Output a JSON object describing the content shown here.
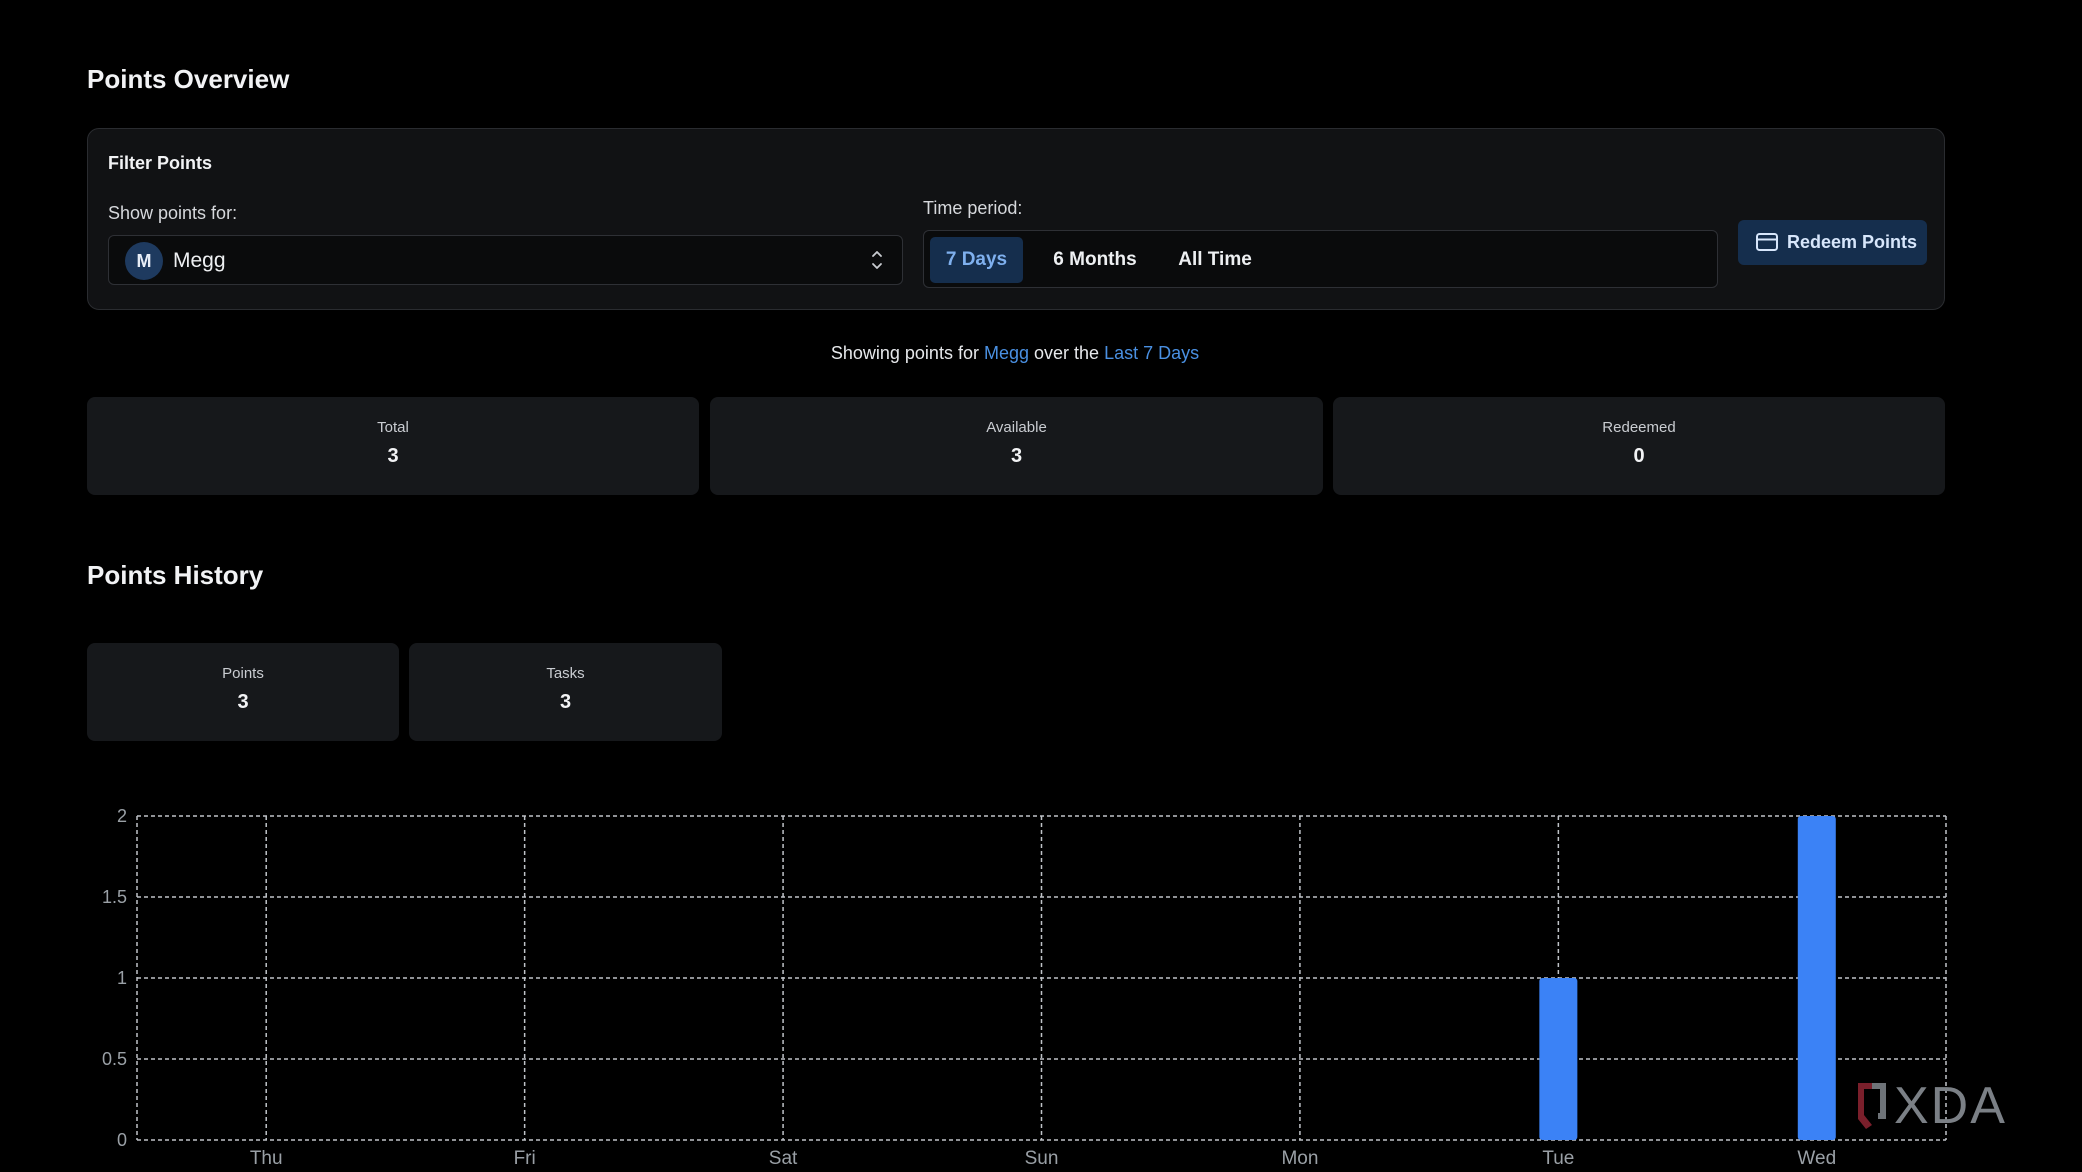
{
  "overview": {
    "title": "Points Overview"
  },
  "filter": {
    "title": "Filter Points",
    "show_label": "Show points for:",
    "selected_person": {
      "initial": "M",
      "name": "Megg"
    },
    "time_label": "Time period:",
    "periods": [
      {
        "label": "7 Days",
        "active": true
      },
      {
        "label": "6 Months",
        "active": false
      },
      {
        "label": "All Time",
        "active": false
      }
    ],
    "redeem_label": "Redeem Points"
  },
  "summary": {
    "prefix": "Showing points for",
    "person": "Megg",
    "middle": "over the",
    "period": "Last 7 Days"
  },
  "stats": [
    {
      "label": "Total",
      "value": "3"
    },
    {
      "label": "Available",
      "value": "3"
    },
    {
      "label": "Redeemed",
      "value": "0"
    }
  ],
  "history": {
    "title": "Points History",
    "stats": [
      {
        "label": "Points",
        "value": "3"
      },
      {
        "label": "Tasks",
        "value": "3"
      }
    ]
  },
  "colors": {
    "accent": "#4a90e2",
    "bar": "#3b82f6",
    "active_tab_bg": "#152e4d"
  },
  "icons": {
    "select_chevron": "chevron-up-down-icon",
    "redeem": "credit-card-icon"
  },
  "watermark": "XDA",
  "chart_data": {
    "type": "bar",
    "categories": [
      "Thu",
      "Fri",
      "Sat",
      "Sun",
      "Mon",
      "Tue",
      "Wed"
    ],
    "values": [
      0,
      0,
      0,
      0,
      0,
      1,
      2
    ],
    "yticks": [
      "0",
      "0.5",
      "1",
      "1.5",
      "2"
    ],
    "ylim": [
      0,
      2
    ],
    "grid": true,
    "title": "",
    "xlabel": "",
    "ylabel": ""
  }
}
